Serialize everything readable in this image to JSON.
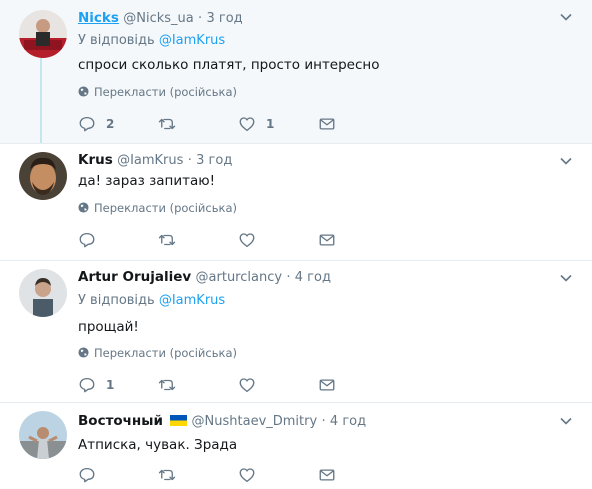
{
  "translate_label": "Перекласти (російська)",
  "tweets": [
    {
      "name": "Nicks",
      "handle": "@Nicks_ua",
      "dot": "·",
      "time": "3 год",
      "reply_prefix": "У відповідь",
      "reply_mention": "@IamKrus",
      "text": "спроси сколько платят, просто интересно",
      "reply_count": "2",
      "retweet_count": "",
      "like_count": "1"
    },
    {
      "name": "Krus",
      "handle": "@IamKrus",
      "dot": "·",
      "time": "3 год",
      "text": "да! зараз запитаю!",
      "reply_count": "",
      "retweet_count": "",
      "like_count": ""
    },
    {
      "name": "Artur Orujaliev",
      "handle": "@arturclancy",
      "dot": "·",
      "time": "4 год",
      "reply_prefix": "У відповідь",
      "reply_mention": "@IamKrus",
      "text": "прощай!",
      "reply_count": "1",
      "retweet_count": "",
      "like_count": ""
    },
    {
      "name": "Восточный",
      "handle": "@Nushtaev_Dmitry",
      "dot": "·",
      "time": "4 год",
      "text": "Атписка, чувак. Зрада"
    }
  ],
  "icons": [
    "reply-icon",
    "retweet-icon",
    "like-icon",
    "message-icon",
    "globe-icon",
    "chevron-down-icon",
    "ukraine-flag-icon"
  ],
  "colors": {
    "link": "#1da1f2",
    "muted": "#657786",
    "thread_line": "#c4e6ee",
    "highlight_bg": "#f5f8fa"
  }
}
